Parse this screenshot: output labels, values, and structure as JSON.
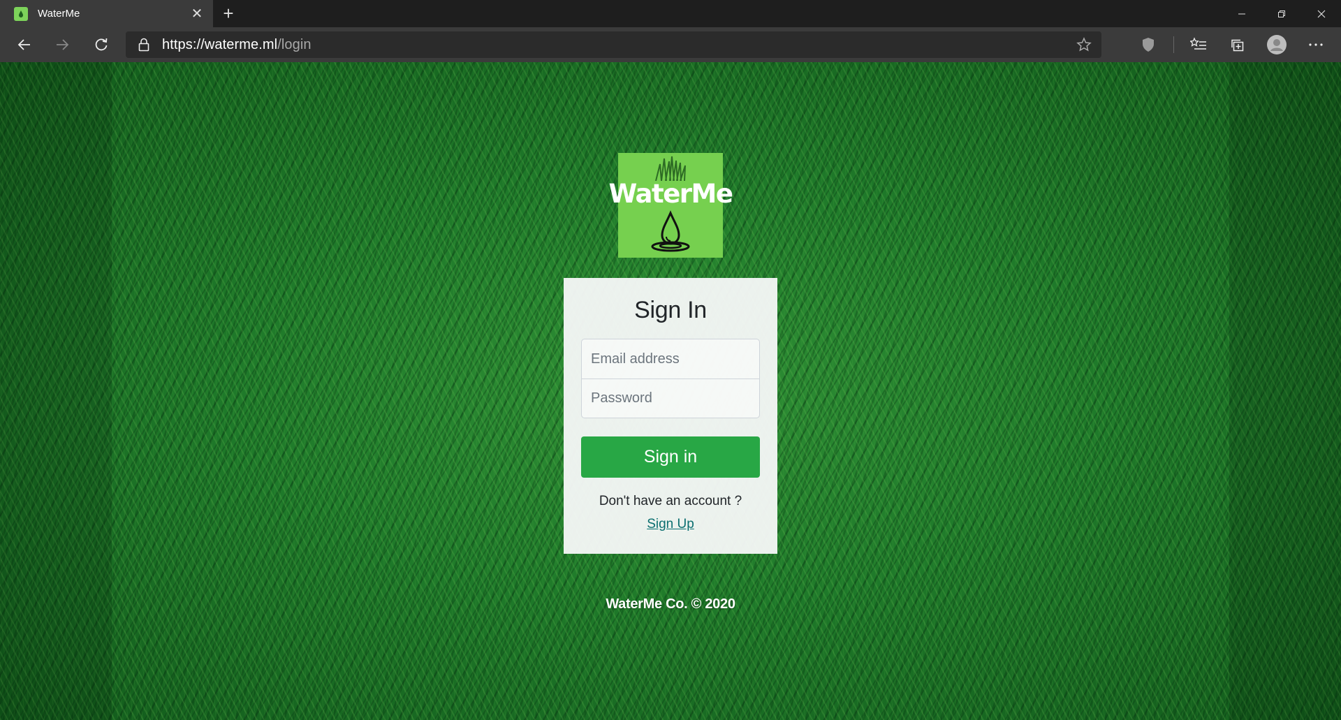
{
  "browser": {
    "tab": {
      "title": "WaterMe",
      "close_icon": "close-icon",
      "favicon": "watering-can-icon"
    },
    "new_tab_icon": "plus-icon",
    "window_controls": [
      "minimize-icon",
      "restore-icon",
      "close-icon"
    ],
    "address_bar": {
      "url_host_prefix": "https://",
      "url_host": "waterme.ml",
      "url_path": "/login",
      "lock_icon": "lock-icon"
    },
    "toolbar_icons": [
      "back-arrow-icon",
      "forward-arrow-icon",
      "refresh-icon",
      "star-icon",
      "shield-icon",
      "favorites-list-icon",
      "collections-icon",
      "profile-icon",
      "more-icon"
    ]
  },
  "page": {
    "logo": {
      "text": "WaterMe"
    },
    "signin": {
      "title": "Sign In",
      "email_placeholder": "Email address",
      "password_placeholder": "Password",
      "submit_label": "Sign in",
      "no_account_text": "Don't have an account ?",
      "signup_link": "Sign Up"
    },
    "footer": "WaterMe Co. © 2020"
  },
  "colors": {
    "accent_green": "#28a745",
    "logo_green": "#76d04f",
    "link": "#0b6f70",
    "chrome_dark": "#3b3b3b"
  }
}
